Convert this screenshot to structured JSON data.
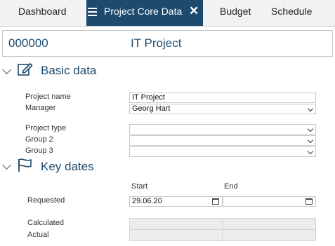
{
  "tabs": {
    "dashboard": "Dashboard",
    "project_core_data": "Project Core Data",
    "budget": "Budget",
    "schedule": "Schedule"
  },
  "header": {
    "project_number": "000000",
    "project_name": "IT Project"
  },
  "basic_data": {
    "title": "Basic data",
    "project_name_label": "Project name",
    "project_name_value": "IT Project",
    "manager_label": "Manager",
    "manager_value": "Georg Hart",
    "project_type_label": "Project type",
    "project_type_value": "",
    "group2_label": "Group 2",
    "group2_value": "",
    "group3_label": "Group 3",
    "group3_value": ""
  },
  "key_dates": {
    "title": "Key dates",
    "start_header": "Start",
    "end_header": "End",
    "requested_label": "Requested",
    "requested_start": "29.06.20",
    "requested_end": "",
    "calculated_label": "Calculated",
    "actual_label": "Actual"
  },
  "colors": {
    "accent": "#1e4a6e",
    "tabbar": "#f2f2f2"
  },
  "icons": [
    "menu-icon",
    "close-icon",
    "edit-icon",
    "flag-icon",
    "calendar-icon",
    "chevron-down-icon"
  ]
}
